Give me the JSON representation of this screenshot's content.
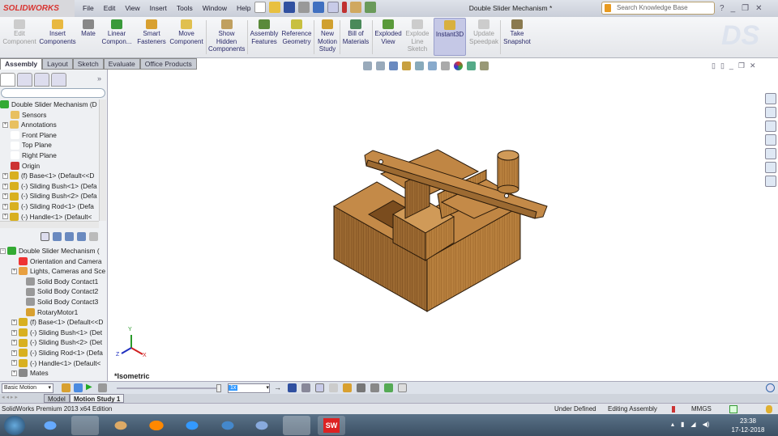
{
  "app": {
    "logo": "SOLIDWORKS",
    "title": "Double Slider Mechanism *"
  },
  "menu": [
    "File",
    "Edit",
    "View",
    "Insert",
    "Tools",
    "Window",
    "Help"
  ],
  "search": {
    "placeholder": "Search Knowledge Base"
  },
  "ribbon": [
    {
      "label": "Edit Component",
      "disabled": true
    },
    {
      "label": "Insert Components"
    },
    {
      "label": "Mate"
    },
    {
      "label": "Linear Compon..."
    },
    {
      "label": "Smart Fasteners"
    },
    {
      "label": "Move Component"
    },
    {
      "label": "Show Hidden Components"
    },
    {
      "label": "Assembly Features"
    },
    {
      "label": "Reference Geometry"
    },
    {
      "label": "New Motion Study"
    },
    {
      "label": "Bill of Materials"
    },
    {
      "label": "Exploded View"
    },
    {
      "label": "Explode Line Sketch",
      "disabled": true
    },
    {
      "label": "Instant3D",
      "active": true
    },
    {
      "label": "Update Speedpak",
      "disabled": true
    },
    {
      "label": "Take Snapshot"
    }
  ],
  "tabs": [
    "Assembly",
    "Layout",
    "Sketch",
    "Evaluate",
    "Office Products"
  ],
  "feature_tree": [
    "Double Slider Mechanism  (D",
    "Sensors",
    "Annotations",
    "Front Plane",
    "Top Plane",
    "Right Plane",
    "Origin",
    "(f) Base<1> (Default<<D",
    "(-) Sliding Bush<1> (Defa",
    "(-) Sliding Bush<2> (Defa",
    "(-) Sliding Rod<1> (Defa",
    "(-) Handle<1> (Default<"
  ],
  "motion_tree": [
    "Double Slider Mechanism  (",
    "Orientation and Camera",
    "Lights, Cameras and Sce",
    "Solid Body Contact1",
    "Solid Body Contact2",
    "Solid Body Contact3",
    "RotaryMotor1",
    "(f) Base<1> (Default<<D",
    "(-) Sliding Bush<1> (Det",
    "(-) Sliding Bush<2> (Det",
    "(-) Sliding Rod<1> (Defa",
    "(-) Handle<1> (Default<",
    "Mates"
  ],
  "view": {
    "orientation": "*Isometric",
    "axes": {
      "x": "X",
      "y": "Y",
      "z": "Z"
    }
  },
  "motion": {
    "study_type": "Basic Motion",
    "speed": "1x",
    "tabs": [
      "Model",
      "Motion Study 1"
    ]
  },
  "status": {
    "edition": "SolidWorks Premium 2013 x64 Edition",
    "state": "Under Defined",
    "mode": "Editing Assembly",
    "units": "MMGS"
  },
  "clock": {
    "time": "23:38",
    "date": "17-12-2018"
  },
  "colors": {
    "wood": "#b8803e",
    "wood_dark": "#8a5a28",
    "accent": "#d9332f"
  }
}
